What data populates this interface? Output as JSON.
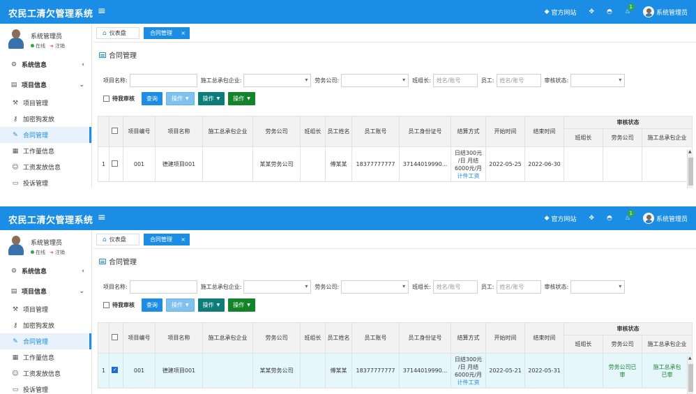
{
  "app": {
    "title": "农民工清欠管理系统",
    "menu_toggle": "≡",
    "official_site": "官方网站",
    "notify_count": "1",
    "user_name": "系统管理员",
    "brand_color": "#1c8de4"
  },
  "sidebar": {
    "user_name": "系统管理员",
    "status_online": "在线",
    "status_logout": "注销",
    "items": [
      {
        "label": "系统信息",
        "icon": "gear-icon",
        "type": "group",
        "arrow": "‹"
      },
      {
        "label": "项目信息",
        "icon": "folder-icon",
        "type": "group",
        "arrow": "⌄"
      },
      {
        "label": "项目管理",
        "icon": "wrench-icon",
        "type": "sub"
      },
      {
        "label": "加密狗发放",
        "icon": "key-icon",
        "type": "sub"
      },
      {
        "label": "合同管理",
        "icon": "edit-icon",
        "type": "sub",
        "active": true
      },
      {
        "label": "工作量信息",
        "icon": "grid-icon",
        "type": "sub"
      },
      {
        "label": "工资发放信息",
        "icon": "people-icon",
        "type": "sub"
      },
      {
        "label": "投诉管理",
        "icon": "message-icon",
        "type": "sub"
      }
    ]
  },
  "tabs": [
    {
      "label": "仪表盘"
    },
    {
      "label": "合同管理",
      "close": "×"
    }
  ],
  "page": {
    "title": "合同管理"
  },
  "filters": {
    "project_name_label": "项目名称:",
    "contractor_label": "施工总承包企业:",
    "labor_company_label": "劳务公司:",
    "team_leader_label": "班组长:",
    "team_leader_placeholder": "姓名/账号",
    "worker_label": "员工:",
    "worker_placeholder": "姓名/账号",
    "audit_status_label": "审核状态:"
  },
  "actions": {
    "pending_label": "待我审核",
    "query": "查询",
    "op1": "操作",
    "op2": "操作",
    "op3": "操作"
  },
  "table": {
    "headers": {
      "project_no": "项目编号",
      "project_name": "项目名称",
      "contractor": "施工总承包企业",
      "labor_company": "劳务公司",
      "team_leader": "班组长",
      "worker_name": "员工姓名",
      "worker_account": "员工账号",
      "worker_id": "员工身份证号",
      "settlement": "结算方式",
      "start_time": "开始时间",
      "end_time": "结束时间",
      "audit_status": "审核状态",
      "audit_team_leader": "班组长",
      "audit_labor": "劳务公司",
      "audit_contractor": "施工总承包企业"
    }
  },
  "screens": [
    {
      "row": {
        "index": "1",
        "checked": false,
        "project_no": "001",
        "project_name": "德建项目001",
        "contractor": "",
        "labor_company": "某某劳务公司",
        "team_leader": "",
        "worker_name": "傅某某",
        "worker_account": "18377777777",
        "worker_id": "37144019990...",
        "settlement_l1": "日结300元",
        "settlement_l2": "/日 月结",
        "settlement_l3": "6000元/月",
        "settlement_link": "计件工资",
        "start_time": "2022-05-25",
        "end_time": "2022-06-30",
        "audit_team_leader": "",
        "audit_labor_l1": "",
        "audit_labor_l2": "",
        "audit_contractor_l1": "",
        "audit_contractor_l2": ""
      }
    },
    {
      "row": {
        "index": "1",
        "checked": true,
        "project_no": "001",
        "project_name": "德建项目001",
        "contractor": "",
        "labor_company": "某某劳务公司",
        "team_leader": "",
        "worker_name": "傅某某",
        "worker_account": "18377777777",
        "worker_id": "37144019990...",
        "settlement_l1": "日结300元",
        "settlement_l2": "/日 月结",
        "settlement_l3": "6000元/月",
        "settlement_link": "计件工资",
        "start_time": "2022-05-21",
        "end_time": "2022-05-31",
        "audit_team_leader": "",
        "audit_labor_l1": "劳务公司已",
        "audit_labor_l2": "审",
        "audit_contractor_l1": "施工总承包",
        "audit_contractor_l2": "已审"
      }
    }
  ]
}
